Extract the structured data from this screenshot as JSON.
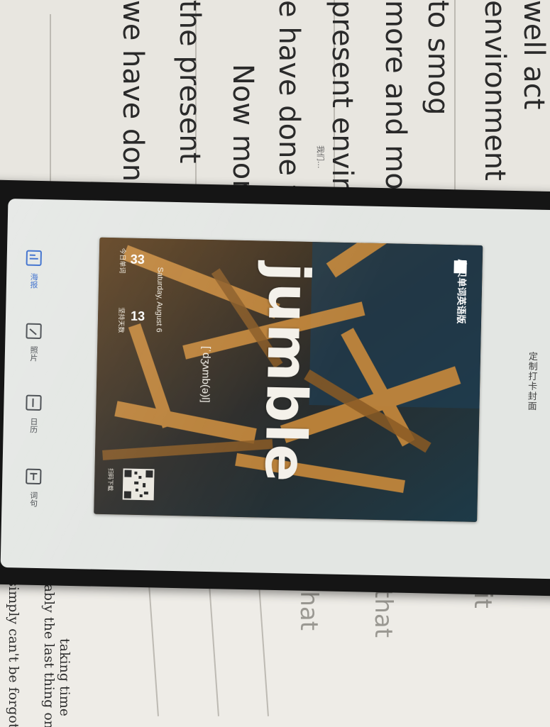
{
  "background": {
    "handwriting_lines": [
      "well act",
      "environment",
      "to smog",
      "more and mo",
      "present enviro",
      "e have done to",
      "the present",
      "we have done"
    ],
    "handwriting_fragment": "Now more",
    "handwriting_note": "我们...",
    "printed_lines": [
      "e simply can't be forgotten",
      "obably the last thing on you",
      "taking time"
    ],
    "ghost_lines": [
      "that",
      "that",
      "it"
    ]
  },
  "app": {
    "header_title": "定制打卡封面",
    "tools": [
      {
        "label": "海报",
        "icon": "poster-icon",
        "active": true
      },
      {
        "label": "照片",
        "icon": "image-icon",
        "active": false
      },
      {
        "label": "日历",
        "icon": "calendar-icon",
        "active": false
      },
      {
        "label": "词句",
        "icon": "text-icon",
        "active": false
      }
    ]
  },
  "poster": {
    "title": "jumble",
    "phonetic": "[ˈdʒʌmb(ə)l]",
    "date": "Saturday, August 6",
    "words_today": "33",
    "words_today_label": "今日单词",
    "days": "13",
    "days_label": "坚持天数",
    "brand": "扇贝单词英语版",
    "qr_label": "扫码下载"
  },
  "colors": {
    "accent": "#2a62c9",
    "screen_bg": "#e3e6e3",
    "phone_body": "#151515"
  }
}
